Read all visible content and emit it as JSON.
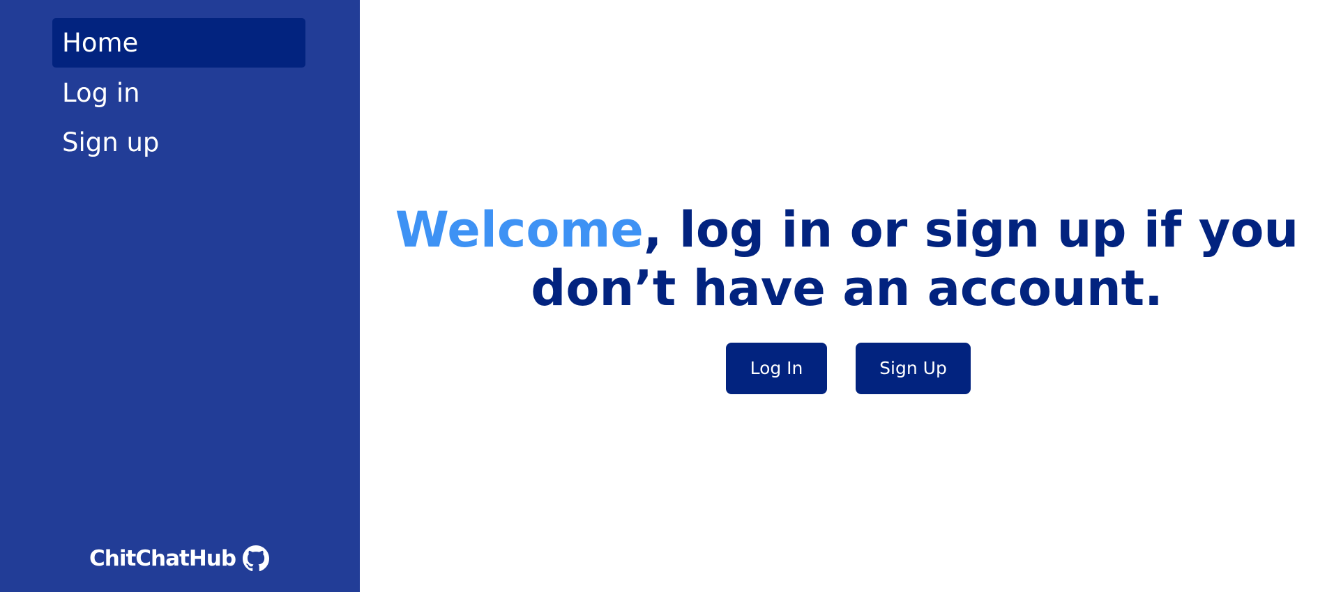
{
  "sidebar": {
    "items": [
      {
        "label": "Home",
        "active": true
      },
      {
        "label": "Log in",
        "active": false
      },
      {
        "label": "Sign up",
        "active": false
      }
    ],
    "footer": {
      "brand": "ChitChatHub",
      "icon": "github-icon"
    }
  },
  "main": {
    "headline_accent": "Welcome",
    "headline_line1_rest": ", log in or sign up if you",
    "headline_line2": "don’t have an account.",
    "login_button": "Log In",
    "signup_button": "Sign Up"
  },
  "colors": {
    "sidebar_bg": "#223d97",
    "active_item_bg": "#02237f",
    "primary": "#02237f",
    "accent": "#3e92f4",
    "text_on_dark": "#ffffff",
    "page_bg": "#ffffff"
  }
}
